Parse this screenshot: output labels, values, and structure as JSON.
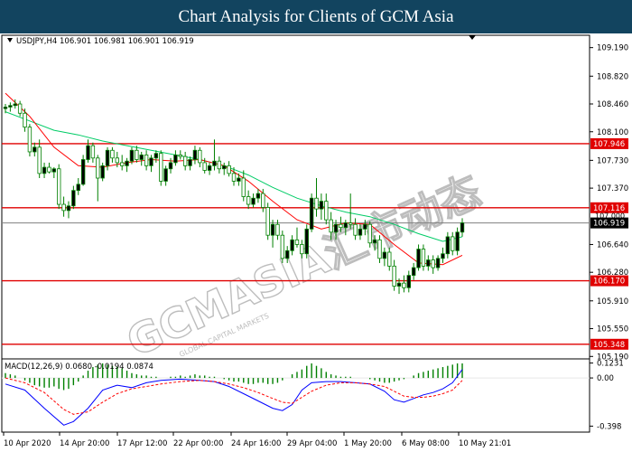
{
  "banner": {
    "title": "Chart Analysis for Clients of GCM Asia"
  },
  "chart_data": {
    "type": "candlestick",
    "symbol_info": "USDJPY,H4  106.901 106.981 106.901 106.919",
    "watermark": "GCMASIA汇市动态",
    "watermark_sub": "GLOBAL CAPITAL MARKETS",
    "colors": {
      "background": "#ffffff",
      "grid": "#c8c8c8",
      "candle": "#008000",
      "ma_fast": "#ff0000",
      "ma_slow": "#00cc66",
      "level": "#e00000",
      "price_line": "#808080",
      "label_bg": "#e00000",
      "macd_hist": "#008000",
      "macd_line": "#0000ff",
      "signal_line": "#ff0000"
    },
    "price_axis": {
      "ticks": [
        "109.190",
        "108.820",
        "108.460",
        "108.100",
        "107.730",
        "107.370",
        "106.640",
        "106.280",
        "105.910",
        "105.550",
        "105.190"
      ],
      "ylim": [
        105.17,
        109.35
      ]
    },
    "partial_tick": "107.000",
    "current_price": "106.919",
    "levels": [
      "107.946",
      "107.116",
      "106.170",
      "105.348"
    ],
    "x_labels": [
      "10 Apr 2020",
      "14 Apr 20:00",
      "17 Apr 12:00",
      "22 Apr 00:00",
      "24 Apr 16:00",
      "29 Apr 04:00",
      "1 May 20:00",
      "6 May 08:00",
      "10 May 21:01"
    ],
    "macd": {
      "label": "MACD(12,26,9) 0.0680 -0.0194 0.0874",
      "ticks": [
        "0.1231",
        "0.00",
        "-0.398"
      ],
      "ylim": [
        -0.44,
        0.15
      ]
    },
    "candles": [
      [
        108.4,
        108.46,
        108.34,
        108.42
      ],
      [
        108.42,
        108.48,
        108.36,
        108.44
      ],
      [
        108.44,
        108.52,
        108.4,
        108.46
      ],
      [
        108.46,
        108.5,
        108.3,
        108.34
      ],
      [
        108.34,
        108.4,
        108.1,
        108.16
      ],
      [
        108.16,
        108.2,
        107.78,
        107.84
      ],
      [
        107.84,
        107.96,
        107.78,
        107.9
      ],
      [
        107.9,
        108.0,
        107.5,
        107.56
      ],
      [
        107.56,
        107.7,
        107.5,
        107.64
      ],
      [
        107.64,
        107.7,
        107.56,
        107.58
      ],
      [
        107.58,
        107.64,
        107.5,
        107.62
      ],
      [
        107.62,
        107.68,
        107.1,
        107.16
      ],
      [
        107.16,
        107.26,
        107.0,
        107.08
      ],
      [
        107.08,
        107.2,
        106.98,
        107.14
      ],
      [
        107.14,
        107.4,
        107.1,
        107.34
      ],
      [
        107.34,
        107.5,
        107.28,
        107.42
      ],
      [
        107.42,
        107.8,
        107.4,
        107.74
      ],
      [
        107.74,
        108.0,
        107.7,
        107.92
      ],
      [
        107.92,
        107.96,
        107.7,
        107.76
      ],
      [
        107.76,
        107.8,
        107.2,
        107.5
      ],
      [
        107.5,
        107.7,
        107.46,
        107.66
      ],
      [
        107.66,
        107.9,
        107.6,
        107.86
      ],
      [
        107.86,
        107.9,
        107.7,
        107.76
      ],
      [
        107.76,
        107.84,
        107.64,
        107.7
      ],
      [
        107.7,
        107.8,
        107.6,
        107.66
      ],
      [
        107.66,
        107.76,
        107.58,
        107.72
      ],
      [
        107.72,
        107.9,
        107.68,
        107.86
      ],
      [
        107.86,
        107.92,
        107.7,
        107.74
      ],
      [
        107.74,
        107.84,
        107.66,
        107.8
      ],
      [
        107.8,
        107.86,
        107.6,
        107.66
      ],
      [
        107.66,
        107.8,
        107.58,
        107.76
      ],
      [
        107.76,
        107.86,
        107.7,
        107.82
      ],
      [
        107.82,
        107.86,
        107.4,
        107.46
      ],
      [
        107.46,
        107.66,
        107.4,
        107.62
      ],
      [
        107.62,
        107.76,
        107.56,
        107.7
      ],
      [
        107.7,
        107.86,
        107.66,
        107.8
      ],
      [
        107.8,
        107.86,
        107.74,
        107.78
      ],
      [
        107.78,
        107.84,
        107.6,
        107.66
      ],
      [
        107.66,
        107.78,
        107.6,
        107.74
      ],
      [
        107.74,
        107.92,
        107.68,
        107.86
      ],
      [
        107.86,
        107.9,
        107.64,
        107.7
      ],
      [
        107.7,
        107.76,
        107.56,
        107.6
      ],
      [
        107.6,
        107.7,
        107.54,
        107.66
      ],
      [
        107.66,
        108.0,
        107.6,
        107.72
      ],
      [
        107.72,
        107.78,
        107.56,
        107.62
      ],
      [
        107.62,
        107.7,
        107.54,
        107.66
      ],
      [
        107.66,
        107.72,
        107.52,
        107.56
      ],
      [
        107.56,
        107.64,
        107.4,
        107.46
      ],
      [
        107.46,
        107.56,
        107.4,
        107.5
      ],
      [
        107.5,
        107.6,
        107.2,
        107.26
      ],
      [
        107.26,
        107.34,
        107.1,
        107.16
      ],
      [
        107.16,
        107.3,
        107.12,
        107.24
      ],
      [
        107.24,
        107.36,
        107.18,
        107.3
      ],
      [
        107.3,
        107.36,
        107.06,
        107.12
      ],
      [
        107.12,
        107.18,
        106.7,
        106.76
      ],
      [
        106.76,
        106.96,
        106.6,
        106.9
      ],
      [
        106.9,
        106.96,
        106.7,
        106.76
      ],
      [
        106.76,
        106.82,
        106.4,
        106.46
      ],
      [
        106.46,
        106.62,
        106.4,
        106.56
      ],
      [
        106.56,
        106.76,
        106.5,
        106.7
      ],
      [
        106.7,
        106.86,
        106.6,
        106.64
      ],
      [
        106.64,
        106.7,
        106.46,
        106.52
      ],
      [
        106.52,
        106.9,
        106.46,
        106.84
      ],
      [
        106.84,
        107.3,
        106.8,
        107.24
      ],
      [
        107.24,
        107.5,
        107.0,
        107.1
      ],
      [
        107.1,
        107.3,
        106.96,
        107.2
      ],
      [
        107.2,
        107.3,
        106.9,
        106.96
      ],
      [
        106.96,
        107.06,
        106.7,
        106.8
      ],
      [
        106.8,
        106.96,
        106.7,
        106.9
      ],
      [
        106.9,
        107.0,
        106.8,
        106.86
      ],
      [
        106.86,
        106.96,
        106.76,
        106.92
      ],
      [
        106.92,
        107.3,
        106.84,
        106.9
      ],
      [
        106.9,
        106.98,
        106.7,
        106.76
      ],
      [
        106.76,
        106.9,
        106.7,
        106.84
      ],
      [
        106.84,
        106.96,
        106.76,
        106.9
      ],
      [
        106.9,
        106.94,
        106.6,
        106.66
      ],
      [
        106.66,
        106.76,
        106.56,
        106.7
      ],
      [
        106.7,
        106.76,
        106.4,
        106.46
      ],
      [
        106.46,
        106.6,
        106.36,
        106.54
      ],
      [
        106.54,
        106.6,
        106.3,
        106.36
      ],
      [
        106.36,
        106.44,
        106.04,
        106.1
      ],
      [
        106.1,
        106.2,
        106.0,
        106.14
      ],
      [
        106.14,
        106.24,
        106.02,
        106.08
      ],
      [
        106.08,
        106.3,
        106.02,
        106.24
      ],
      [
        106.24,
        106.4,
        106.18,
        106.34
      ],
      [
        106.34,
        106.64,
        106.3,
        106.58
      ],
      [
        106.58,
        106.64,
        106.3,
        106.36
      ],
      [
        106.36,
        106.5,
        106.3,
        106.44
      ],
      [
        106.44,
        106.5,
        106.26,
        106.34
      ],
      [
        106.34,
        106.5,
        106.3,
        106.46
      ],
      [
        106.46,
        106.6,
        106.4,
        106.52
      ],
      [
        106.52,
        106.8,
        106.46,
        106.74
      ],
      [
        106.74,
        106.8,
        106.5,
        106.56
      ],
      [
        106.56,
        106.86,
        106.5,
        106.8
      ],
      [
        106.8,
        106.98,
        106.74,
        106.92
      ]
    ],
    "ma_fast": [
      [
        0,
        108.6
      ],
      [
        5,
        108.3
      ],
      [
        10,
        107.9
      ],
      [
        15,
        107.66
      ],
      [
        20,
        107.64
      ],
      [
        25,
        107.7
      ],
      [
        30,
        107.74
      ],
      [
        35,
        107.72
      ],
      [
        40,
        107.74
      ],
      [
        45,
        107.66
      ],
      [
        50,
        107.46
      ],
      [
        55,
        107.2
      ],
      [
        60,
        106.96
      ],
      [
        65,
        106.84
      ],
      [
        70,
        106.92
      ],
      [
        75,
        106.9
      ],
      [
        80,
        106.64
      ],
      [
        85,
        106.4
      ],
      [
        90,
        106.38
      ],
      [
        94,
        106.5
      ]
    ],
    "ma_slow": [
      [
        0,
        108.36
      ],
      [
        5,
        108.24
      ],
      [
        10,
        108.12
      ],
      [
        15,
        108.06
      ],
      [
        20,
        107.98
      ],
      [
        25,
        107.92
      ],
      [
        30,
        107.86
      ],
      [
        35,
        107.8
      ],
      [
        40,
        107.74
      ],
      [
        45,
        107.66
      ],
      [
        50,
        107.54
      ],
      [
        55,
        107.38
      ],
      [
        60,
        107.24
      ],
      [
        65,
        107.14
      ],
      [
        70,
        107.06
      ],
      [
        75,
        107.0
      ],
      [
        80,
        106.9
      ],
      [
        85,
        106.78
      ],
      [
        90,
        106.68
      ],
      [
        94,
        106.74
      ]
    ],
    "macd_hist": [
      0.04,
      0.03,
      0.02,
      0.0,
      -0.02,
      -0.04,
      -0.06,
      -0.07,
      -0.08,
      -0.08,
      -0.07,
      -0.09,
      -0.1,
      -0.09,
      -0.06,
      -0.03,
      0.02,
      0.06,
      0.09,
      0.11,
      0.12,
      0.11,
      0.1,
      0.09,
      0.08,
      0.06,
      0.04,
      0.03,
      0.02,
      0.02,
      0.01,
      0.01,
      0.0,
      0.0,
      0.01,
      0.01,
      0.02,
      0.01,
      0.02,
      0.03,
      0.02,
      0.02,
      0.01,
      0.01,
      0.0,
      -0.01,
      -0.02,
      -0.03,
      -0.03,
      -0.04,
      -0.05,
      -0.05,
      -0.04,
      -0.04,
      -0.05,
      -0.05,
      -0.04,
      -0.02,
      0.0,
      0.03,
      0.05,
      0.07,
      0.1,
      0.12,
      0.1,
      0.08,
      0.05,
      0.03,
      0.02,
      0.01,
      0.01,
      0.01,
      0.0,
      0.0,
      0.0,
      -0.01,
      -0.02,
      -0.03,
      -0.04,
      -0.04,
      -0.03,
      -0.02,
      -0.01,
      0.0,
      0.02,
      0.04,
      0.05,
      0.06,
      0.07,
      0.08,
      0.09,
      0.1,
      0.11,
      0.12,
      0.12
    ],
    "macd_line": [
      [
        0,
        -0.05
      ],
      [
        4,
        -0.1
      ],
      [
        8,
        -0.25
      ],
      [
        12,
        -0.39
      ],
      [
        14,
        -0.36
      ],
      [
        17,
        -0.25
      ],
      [
        20,
        -0.1
      ],
      [
        23,
        -0.06
      ],
      [
        26,
        -0.08
      ],
      [
        29,
        -0.04
      ],
      [
        32,
        -0.02
      ],
      [
        36,
        -0.01
      ],
      [
        40,
        -0.02
      ],
      [
        43,
        -0.03
      ],
      [
        46,
        -0.07
      ],
      [
        49,
        -0.13
      ],
      [
        52,
        -0.19
      ],
      [
        55,
        -0.25
      ],
      [
        57,
        -0.27
      ],
      [
        59,
        -0.22
      ],
      [
        61,
        -0.1
      ],
      [
        63,
        -0.04
      ],
      [
        66,
        -0.03
      ],
      [
        69,
        -0.03
      ],
      [
        72,
        -0.04
      ],
      [
        75,
        -0.05
      ],
      [
        78,
        -0.11
      ],
      [
        80,
        -0.18
      ],
      [
        82,
        -0.2
      ],
      [
        84,
        -0.17
      ],
      [
        86,
        -0.14
      ],
      [
        88,
        -0.12
      ],
      [
        90,
        -0.09
      ],
      [
        92,
        -0.04
      ],
      [
        94,
        0.07
      ]
    ],
    "signal_line": [
      [
        0,
        0.0
      ],
      [
        4,
        -0.04
      ],
      [
        8,
        -0.12
      ],
      [
        12,
        -0.26
      ],
      [
        14,
        -0.3
      ],
      [
        17,
        -0.28
      ],
      [
        20,
        -0.2
      ],
      [
        23,
        -0.13
      ],
      [
        26,
        -0.09
      ],
      [
        29,
        -0.07
      ],
      [
        32,
        -0.05
      ],
      [
        36,
        -0.03
      ],
      [
        40,
        -0.02
      ],
      [
        43,
        -0.03
      ],
      [
        46,
        -0.05
      ],
      [
        49,
        -0.08
      ],
      [
        52,
        -0.12
      ],
      [
        55,
        -0.17
      ],
      [
        57,
        -0.2
      ],
      [
        59,
        -0.21
      ],
      [
        61,
        -0.16
      ],
      [
        63,
        -0.11
      ],
      [
        66,
        -0.06
      ],
      [
        69,
        -0.04
      ],
      [
        72,
        -0.04
      ],
      [
        75,
        -0.05
      ],
      [
        78,
        -0.07
      ],
      [
        80,
        -0.11
      ],
      [
        82,
        -0.15
      ],
      [
        84,
        -0.16
      ],
      [
        86,
        -0.16
      ],
      [
        88,
        -0.15
      ],
      [
        90,
        -0.13
      ],
      [
        92,
        -0.1
      ],
      [
        94,
        -0.02
      ]
    ]
  }
}
